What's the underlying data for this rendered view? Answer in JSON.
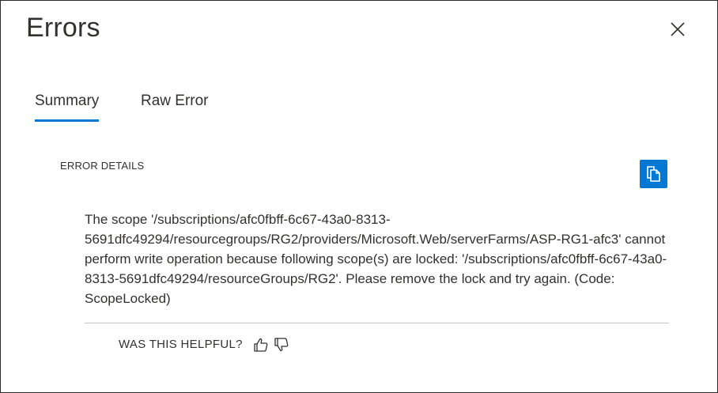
{
  "dialog": {
    "title": "Errors",
    "close_icon": "close-icon"
  },
  "tabs": [
    {
      "label": "Summary",
      "active": true
    },
    {
      "label": "Raw Error",
      "active": false
    }
  ],
  "details": {
    "section_label": "ERROR DETAILS",
    "copy_icon": "copy-icon",
    "message": "The scope '/subscriptions/afc0fbff-6c67-43a0-8313-5691dfc49294/resourcegroups/RG2/providers/Microsoft.Web/serverFarms/ASP-RG1-afc3' cannot perform write operation because following scope(s) are locked: '/subscriptions/afc0fbff-6c67-43a0-8313-5691dfc49294/resourceGroups/RG2'. Please remove the lock and try again. (Code: ScopeLocked)"
  },
  "feedback": {
    "question": "WAS THIS HELPFUL?",
    "thumbs_up_icon": "thumbs-up-icon",
    "thumbs_down_icon": "thumbs-down-icon"
  },
  "colors": {
    "accent": "#0078d4",
    "text": "#323130",
    "divider": "#c8c6c4"
  }
}
